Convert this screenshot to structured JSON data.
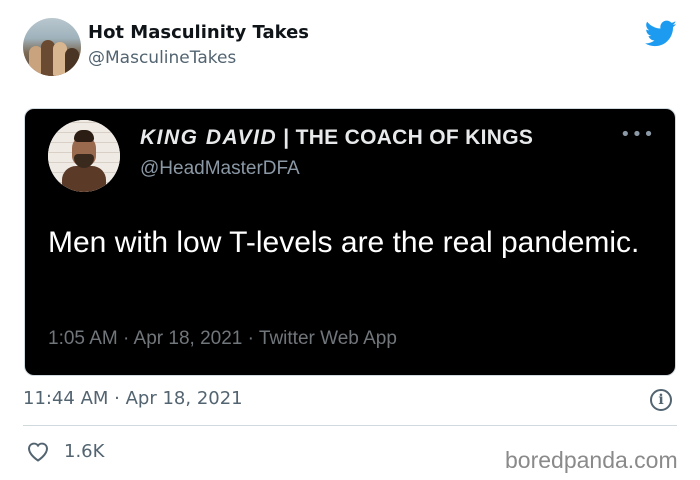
{
  "tweet": {
    "display_name": "Hot Masculinity Takes",
    "handle": "@MasculineTakes",
    "timestamp": "11:44 AM · Apr 18, 2021",
    "likes": "1.6K",
    "brand_color": "#1d9bf0"
  },
  "embedded": {
    "name_italic": "KING DAVID",
    "name_rest": "| THE COACH OF KINGS",
    "handle": "@HeadMasterDFA",
    "text": "Men with low T-levels are the real pandemic.",
    "meta": "1:05 AM · Apr 18, 2021 · Twitter Web App",
    "more_label": "•••",
    "background": "#000000"
  },
  "icons": {
    "bird": "twitter-bird-icon",
    "info": "info-icon",
    "heart": "heart-icon",
    "info_glyph": "i"
  },
  "watermark": "boredpanda.com"
}
